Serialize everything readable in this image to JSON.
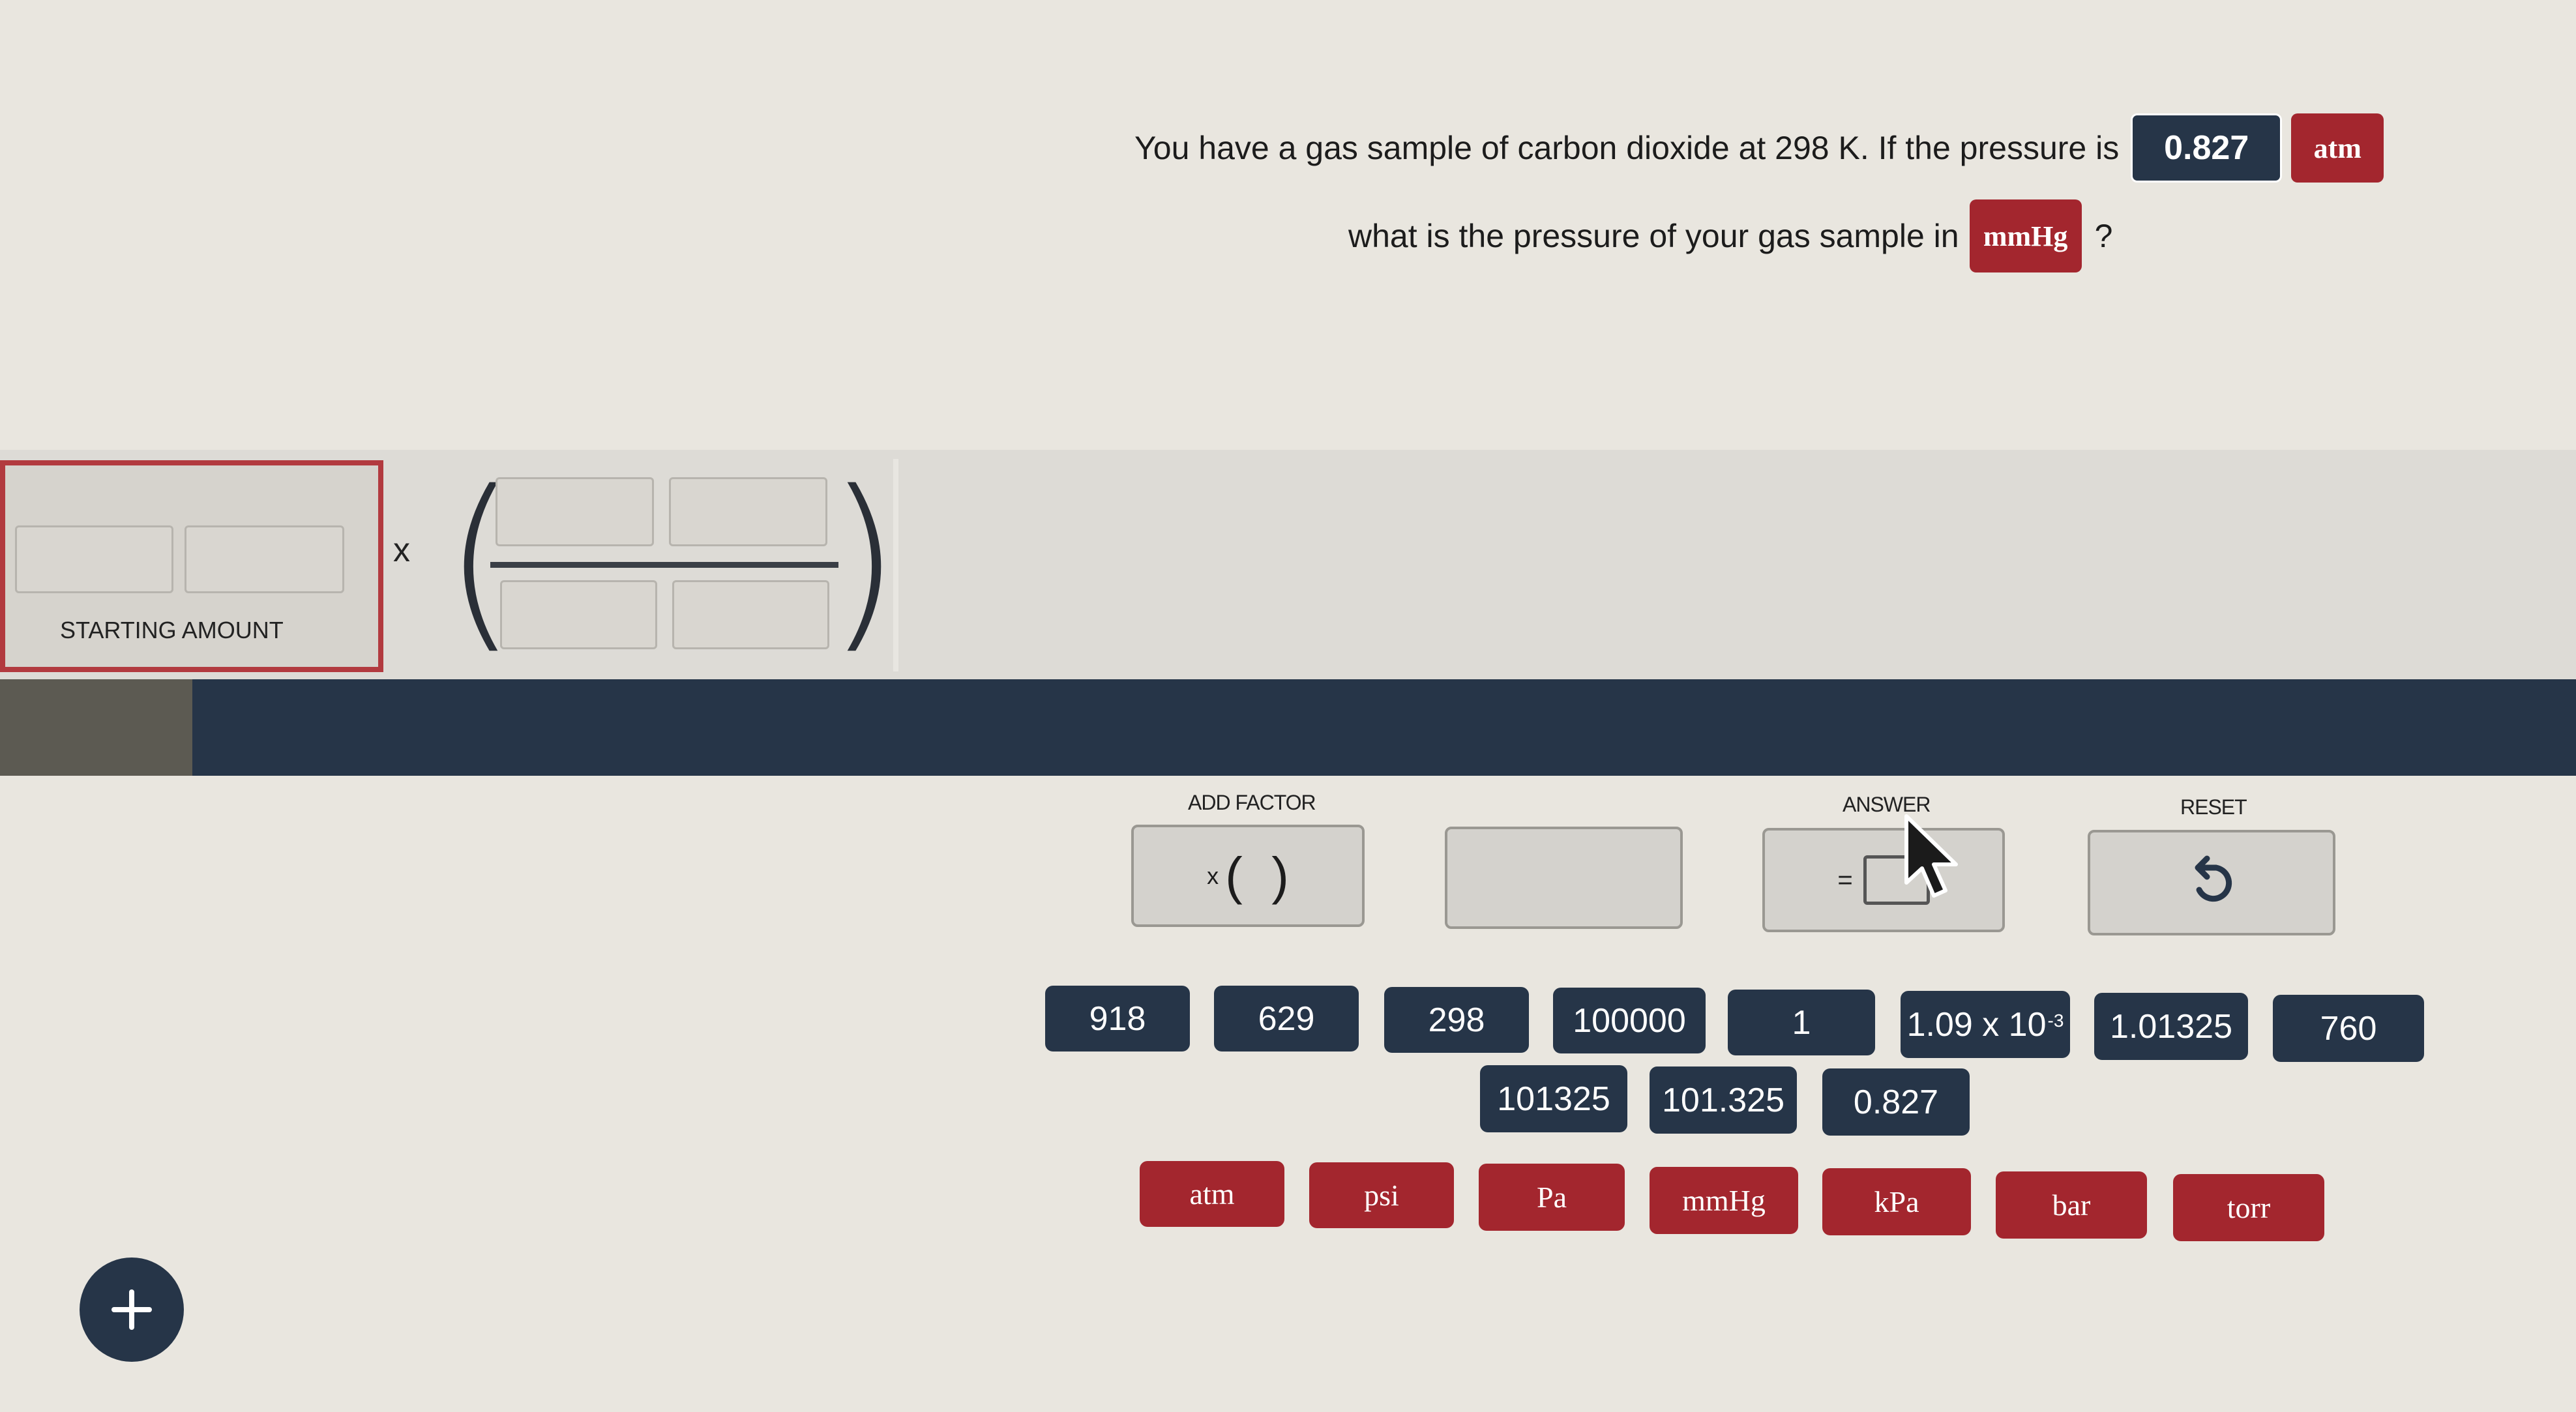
{
  "question": {
    "line1_text": "You have a gas sample of carbon dioxide at 298 K. If the pressure is",
    "given_value": "0.827",
    "given_unit": "atm",
    "line2_text": "what is the pressure of your gas sample in",
    "target_unit": "mmHg",
    "end_mark": "?"
  },
  "workspace": {
    "times_symbol": "x",
    "starting_amount_label": "STARTING AMOUNT"
  },
  "tools": {
    "add_factor_label": "ADD FACTOR",
    "add_factor_times": "x",
    "add_factor_parens": "(  )",
    "answer_label": "ANSWER",
    "answer_equals": "=",
    "reset_label": "RESET"
  },
  "number_tiles": [
    "918",
    "629",
    "298",
    "100000",
    "1",
    "1.09 x 10",
    "1.01325",
    "760",
    "101325",
    "101.325",
    "0.827"
  ],
  "number_tile_exponent": "-3",
  "unit_tiles": [
    "atm",
    "psi",
    "Pa",
    "mmHg",
    "kPa",
    "bar",
    "torr"
  ],
  "icons": {
    "reset": "undo-arrow-icon",
    "add": "plus-icon",
    "cursor": "mouse-pointer-icon"
  },
  "colors": {
    "navy": "#263548",
    "red": "#a3262e",
    "starting_border": "#b23a3f"
  }
}
